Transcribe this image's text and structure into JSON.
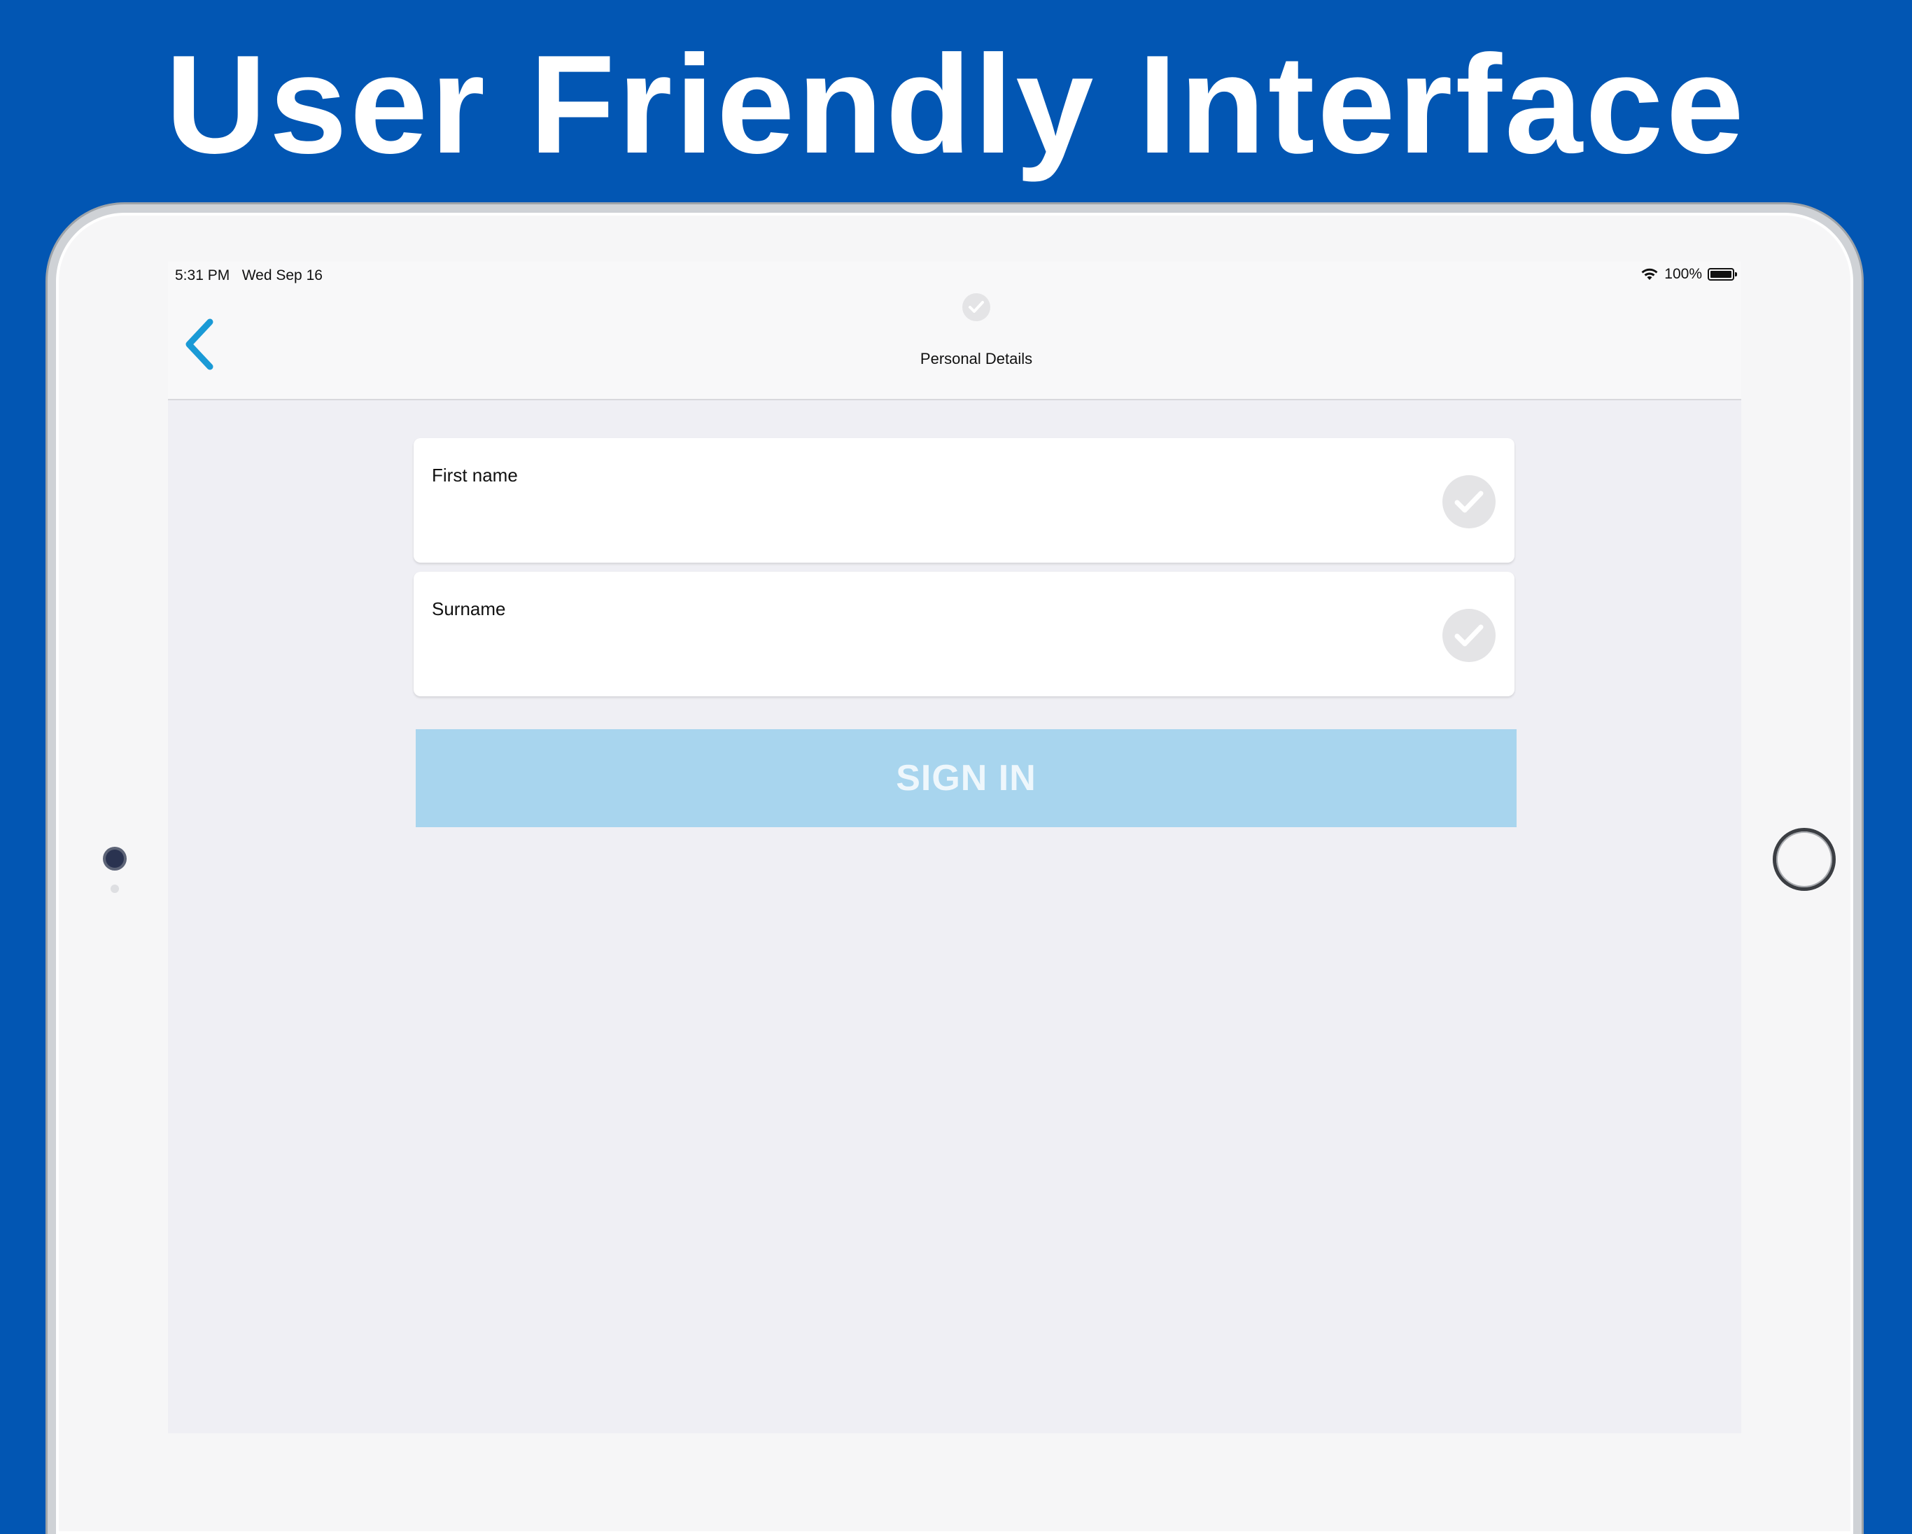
{
  "headline": "User Friendly Interface",
  "status_bar": {
    "time": "5:31 PM",
    "date": "Wed Sep 16",
    "battery_percent": "100%",
    "battery_level": 1.0,
    "wifi_icon": "wifi-icon",
    "battery_icon": "battery-icon"
  },
  "navbar": {
    "back_icon": "chevron-left-icon",
    "title": "Personal Details",
    "progress_icon": "check-circle-icon"
  },
  "form": {
    "first_name": {
      "label": "First name",
      "value": "",
      "check_icon": "check-circle-icon"
    },
    "surname": {
      "label": "Surname",
      "value": "",
      "check_icon": "check-circle-icon"
    }
  },
  "sign_in_label": "SIGN IN",
  "colors": {
    "background": "#0256b3",
    "accent": "#1a9ad6",
    "button_disabled": "#a8d5ee",
    "check_disabled": "#e4e4e6"
  }
}
